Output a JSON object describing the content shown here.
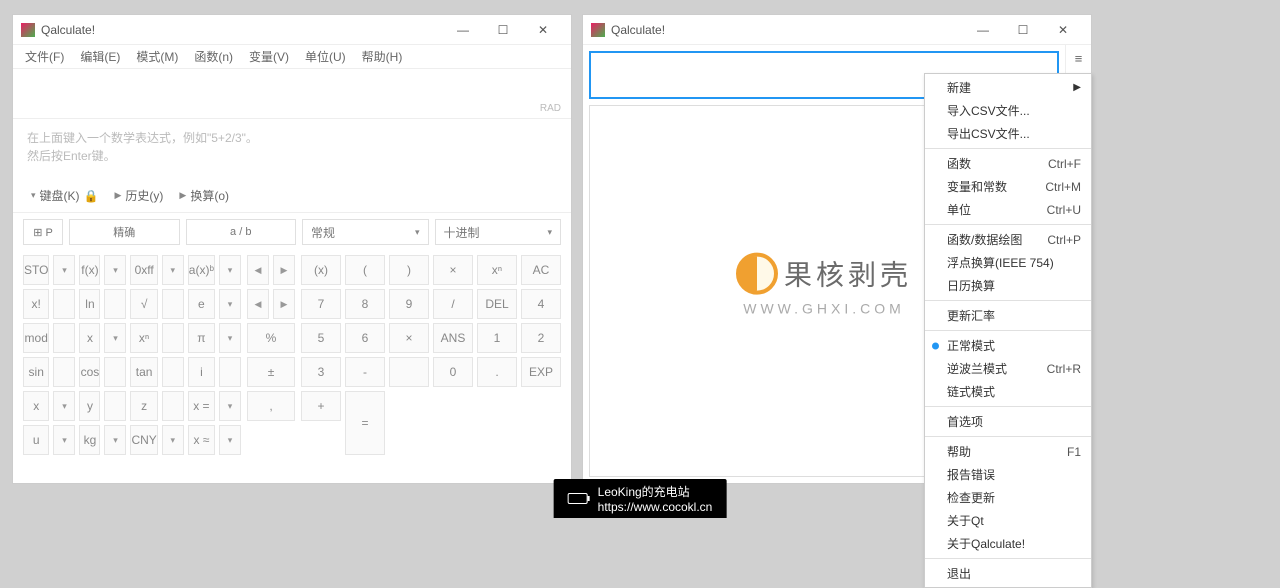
{
  "app_title": "Qalculate!",
  "win_left": {
    "menus": [
      "文件(F)",
      "编辑(E)",
      "模式(M)",
      "函数(n)",
      "变量(V)",
      "单位(U)",
      "帮助(H)"
    ],
    "rad_label": "RAD",
    "hint_line1": "在上面键入一个数学表达式，例如\"5+2/3\"。",
    "hint_line2": "然后按Enter键。",
    "tabs": {
      "keyboard": "键盘(K)",
      "history": "历史(y)",
      "convert": "换算(o)"
    },
    "opts": {
      "p_icon": "⊞ P",
      "exact": "精确",
      "fraction": "a / b",
      "normal": "常规",
      "decimal": "十进制"
    },
    "keys_left": [
      [
        "STO",
        "▾",
        "f(x)",
        "▾",
        "0xff",
        "▾",
        "a(x)ᵇ",
        "▾"
      ],
      [
        "x!",
        "",
        "ln",
        "",
        "√",
        "",
        "e",
        "▾"
      ],
      [
        "mod",
        "",
        "x",
        "▾",
        "xⁿ",
        "",
        "π",
        "▾"
      ],
      [
        "sin",
        "",
        "cos",
        "",
        "tan",
        "",
        "i",
        ""
      ],
      [
        "x",
        "▾",
        "y",
        "",
        "z",
        "",
        "x =",
        "▾"
      ],
      [
        "u",
        "▾",
        "kg",
        "▾",
        "CNY",
        "▾",
        "x ≈",
        "▾"
      ]
    ],
    "keys_mid": [
      "<",
      ">",
      "<",
      ">",
      "%",
      "±",
      ","
    ],
    "keys_right": [
      [
        "(x)",
        "(",
        ")",
        "×",
        "xⁿ",
        "AC"
      ],
      [
        "7",
        "8",
        "9",
        "/",
        "",
        "DEL"
      ],
      [
        "4",
        "5",
        "6",
        "×",
        "",
        "ANS"
      ],
      [
        "1",
        "2",
        "3",
        "-",
        "",
        ""
      ],
      [
        "0",
        ".",
        "EXP",
        "+",
        "",
        "="
      ]
    ]
  },
  "win_right": {
    "toolbar_icons": [
      "menu",
      "adjust",
      "swap",
      "save",
      "fx",
      "binary",
      "grid"
    ],
    "menu_items": [
      {
        "label": "新建",
        "arrow": true
      },
      {
        "label": "导入CSV文件..."
      },
      {
        "label": "导出CSV文件..."
      },
      {
        "sep": true
      },
      {
        "label": "函数",
        "shortcut": "Ctrl+F"
      },
      {
        "label": "变量和常数",
        "shortcut": "Ctrl+M"
      },
      {
        "label": "单位",
        "shortcut": "Ctrl+U"
      },
      {
        "sep": true
      },
      {
        "label": "函数/数据绘图",
        "shortcut": "Ctrl+P"
      },
      {
        "label": "浮点换算(IEEE 754)"
      },
      {
        "label": "日历换算"
      },
      {
        "sep": true
      },
      {
        "label": "更新汇率"
      },
      {
        "sep": true
      },
      {
        "label": "正常模式",
        "radio": true
      },
      {
        "label": "逆波兰模式",
        "shortcut": "Ctrl+R"
      },
      {
        "label": "链式模式"
      },
      {
        "sep": true
      },
      {
        "label": "首选项"
      },
      {
        "sep": true
      },
      {
        "label": "帮助",
        "shortcut": "F1"
      },
      {
        "label": "报告错误"
      },
      {
        "label": "检查更新"
      },
      {
        "label": "关于Qt"
      },
      {
        "label": "关于Qalculate!"
      },
      {
        "sep": true
      },
      {
        "label": "退出"
      }
    ]
  },
  "watermark": {
    "text": "果核剥壳",
    "url": "WWW.GHXI.COM"
  },
  "footer": {
    "name": "LeoKing的充电站",
    "url": "https://www.cocokl.cn"
  }
}
